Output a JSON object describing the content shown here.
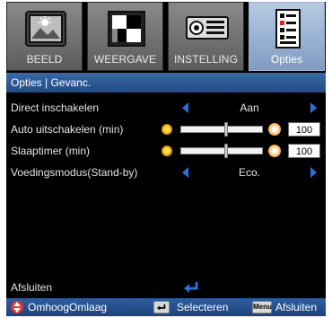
{
  "tabs": [
    {
      "label": "BEELD",
      "icon": "picture-icon",
      "active": false
    },
    {
      "label": "WEERGAVE",
      "icon": "display-icon",
      "active": false
    },
    {
      "label": "INSTELLING",
      "icon": "projector-icon",
      "active": false
    },
    {
      "label": "Opties",
      "icon": "options-list-icon",
      "active": true
    }
  ],
  "breadcrumb": "Opties | Gevanc.",
  "rows": {
    "direct_power_on": {
      "label": "Direct inschakelen",
      "value": "Aan"
    },
    "auto_power_off": {
      "label": "Auto uitschakelen (min)",
      "value": "100",
      "level": 0.55
    },
    "sleep_timer": {
      "label": "Slaaptimer (min)",
      "value": "100",
      "level": 0.55
    },
    "power_mode": {
      "label": "Voedingsmodus(Stand-by)",
      "value": "Eco."
    }
  },
  "exit_label": "Afsluiten",
  "footer": {
    "updown_label": "OmhoogOmlaag",
    "enter_label": "Selecteren",
    "menu_key": "Menu",
    "menu_label": "Afsluiten"
  },
  "colors": {
    "accent_blue": "#2d6fd8",
    "header_blue": "#2f5e9f",
    "active_tab": "#9fb4d1"
  }
}
